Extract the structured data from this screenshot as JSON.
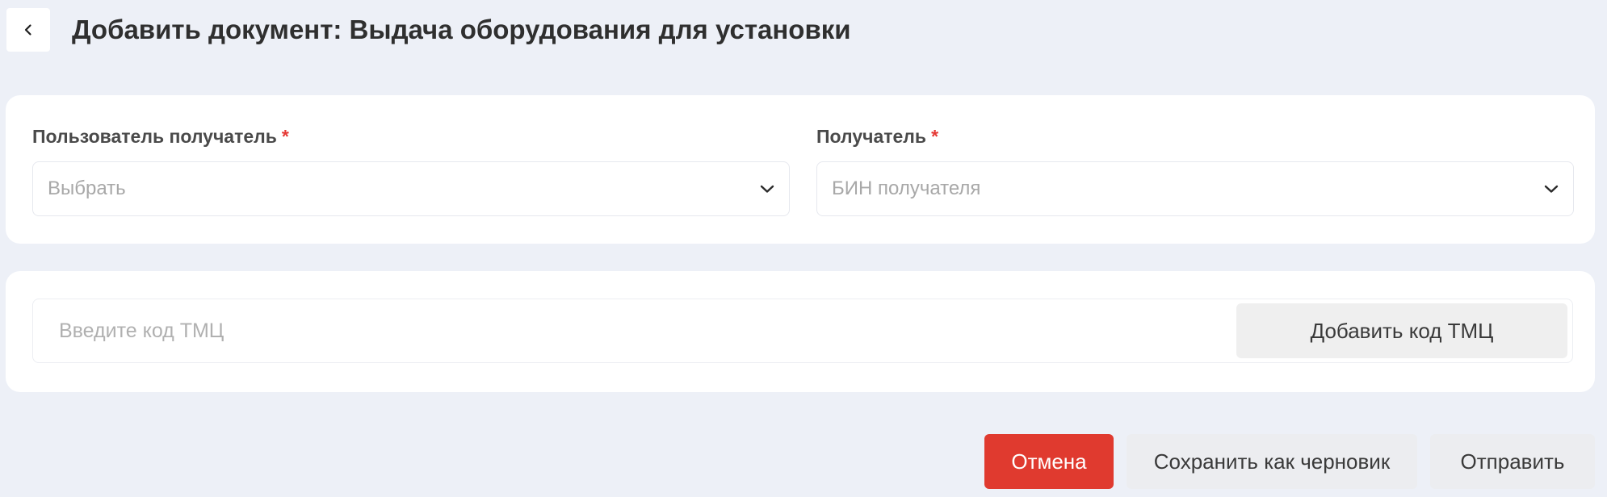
{
  "header": {
    "back_icon": "chevron-left-icon",
    "title": "Добавить документ: Выдача оборудования для установки"
  },
  "recipients": {
    "user_recipient": {
      "label": "Пользователь получатель",
      "required_mark": "*",
      "placeholder": "Выбрать",
      "icon": "chevron-down-icon"
    },
    "recipient": {
      "label": "Получатель",
      "required_mark": "*",
      "placeholder": "БИН получателя",
      "icon": "chevron-down-icon"
    }
  },
  "tmc": {
    "input_placeholder": "Введите код ТМЦ",
    "input_value": "",
    "add_button_label": "Добавить код ТМЦ"
  },
  "actions": {
    "cancel_label": "Отмена",
    "draft_label": "Сохранить как черновик",
    "send_label": "Отправить"
  },
  "colors": {
    "page_background": "#edf0f7",
    "card_background": "#ffffff",
    "cancel_button": "#e03a2f",
    "required_mark": "#e53935",
    "secondary_button": "#ecedf0"
  }
}
